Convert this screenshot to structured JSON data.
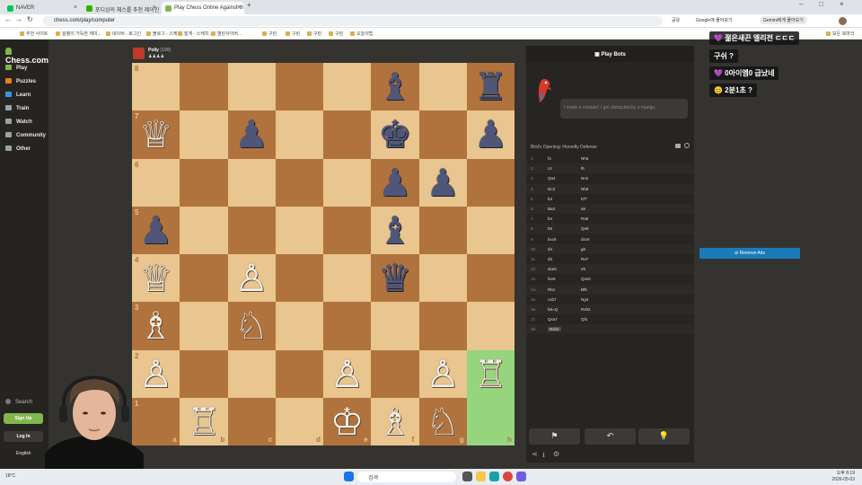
{
  "browser": {
    "tabs": [
      {
        "label": "NAVER",
        "color": "#03c75a"
      },
      {
        "label": "포디싱의 체스를 추천 제이민",
        "color": "#2db400"
      },
      {
        "label": "Play Chess Online Against th",
        "color": "#81b64c",
        "active": true
      }
    ],
    "url": "chess.com/play/computer",
    "right_buttons": [
      "공유",
      "Google에 물어보기"
    ],
    "gemini_label": "Gemini에게 물어보기",
    "bookmarks": [
      "추천 사이트",
      "설렘이 가득한 재미...",
      "네이버 - 로그인",
      "블로그 - 스케치...",
      "빌게 - 스케치...",
      "열린사이버...",
      "구린",
      "구린",
      "구린",
      "구린",
      "오늘의팁"
    ],
    "all_bookmarks": "모든 북마크"
  },
  "sidebar": {
    "logo": "Chess.com",
    "items": [
      {
        "label": "Play",
        "color": "#81b64c"
      },
      {
        "label": "Puzzles",
        "color": "#e67e22"
      },
      {
        "label": "Learn",
        "color": "#3498db"
      },
      {
        "label": "Train",
        "color": "#95a5a6"
      },
      {
        "label": "Watch",
        "color": "#95a5a6"
      },
      {
        "label": "Community",
        "color": "#95a5a6"
      },
      {
        "label": "Other",
        "color": "#95a5a6"
      }
    ],
    "search": "Search",
    "signup": "Sign Up",
    "login": "Log In",
    "language": "English"
  },
  "opponent": {
    "name": "Polly",
    "rating": "(100)",
    "captured": "♟♟♟♟"
  },
  "board": {
    "ranks": [
      "8",
      "7",
      "6",
      "5",
      "4",
      "3",
      "2",
      "1"
    ],
    "files": [
      "a",
      "b",
      "c",
      "d",
      "e",
      "f",
      "g",
      "h"
    ],
    "highlight": [
      "h2",
      "h1"
    ],
    "pieces": [
      {
        "sq": "f8",
        "g": "♝",
        "c": "black"
      },
      {
        "sq": "h8",
        "g": "♜",
        "c": "black"
      },
      {
        "sq": "a7",
        "g": "♕",
        "c": "white"
      },
      {
        "sq": "c7",
        "g": "♟",
        "c": "black"
      },
      {
        "sq": "f7",
        "g": "♚",
        "c": "black"
      },
      {
        "sq": "h7",
        "g": "♟",
        "c": "black"
      },
      {
        "sq": "f6",
        "g": "♟",
        "c": "black"
      },
      {
        "sq": "g6",
        "g": "♟",
        "c": "black"
      },
      {
        "sq": "a5",
        "g": "♟",
        "c": "black"
      },
      {
        "sq": "f5",
        "g": "♝",
        "c": "black"
      },
      {
        "sq": "a4",
        "g": "♕",
        "c": "white"
      },
      {
        "sq": "c4",
        "g": "♙",
        "c": "white"
      },
      {
        "sq": "f4",
        "g": "♛",
        "c": "black"
      },
      {
        "sq": "a3",
        "g": "♗",
        "c": "white"
      },
      {
        "sq": "c3",
        "g": "♘",
        "c": "white"
      },
      {
        "sq": "a2",
        "g": "♙",
        "c": "white"
      },
      {
        "sq": "e2",
        "g": "♙",
        "c": "white"
      },
      {
        "sq": "g2",
        "g": "♙",
        "c": "white"
      },
      {
        "sq": "h2",
        "g": "♖",
        "c": "white"
      },
      {
        "sq": "b1",
        "g": "♖",
        "c": "white"
      },
      {
        "sq": "e1",
        "g": "♔",
        "c": "white"
      },
      {
        "sq": "f1",
        "g": "♗",
        "c": "white"
      },
      {
        "sq": "g1",
        "g": "♘",
        "c": "white"
      }
    ]
  },
  "panel": {
    "title": "Play Bots",
    "bubble": "I made a mistake! I got distracted by a mango.",
    "opening": "Bird's Opening: Horsefly Defense",
    "moves": [
      [
        "1.",
        "f4",
        "Nh6"
      ],
      [
        "2.",
        "c4",
        "f6"
      ],
      [
        "3.",
        "Qa4",
        "Nc6"
      ],
      [
        "4.",
        "Nc3",
        "Nb8"
      ],
      [
        "5.",
        "b3",
        "Kf7"
      ],
      [
        "6.",
        "Ba3",
        "a5"
      ],
      [
        "7.",
        "b4",
        "Ra6"
      ],
      [
        "8.",
        "b5",
        "Qe8"
      ],
      [
        "9.",
        "bxc6",
        "dxc6"
      ],
      [
        "10.",
        "d4",
        "g6"
      ],
      [
        "11.",
        "d3",
        "Ra7"
      ],
      [
        "12.",
        "dxe6",
        "e5"
      ],
      [
        "13.",
        "fxe5",
        "Qxe5"
      ],
      [
        "14.",
        "Rb1",
        "Bf5"
      ],
      [
        "15.",
        "cxb7",
        "Ng4"
      ],
      [
        "16.",
        "b8=Q",
        "Rxb2"
      ],
      [
        "17.",
        "Qxa7",
        "Qf4"
      ],
      [
        "18.",
        "Rxh2",
        ""
      ]
    ],
    "buttons": [
      "⚑",
      "↶",
      "💡"
    ],
    "bottom_icons": [
      "⋖",
      "⭳",
      "⚙"
    ]
  },
  "chat": [
    "💜 젊은새끈 엘리전 ㄷㄷㄷ",
    "구쉬 ?",
    "💜 0아이엠0 급났네",
    "😊 2분1초 ?"
  ],
  "remove_ads": "⊘ Remove Ads",
  "taskbar": {
    "search": "검색",
    "time": "오후 8:19",
    "date": "2026-05-03",
    "weather": "18°C"
  },
  "colors": {
    "light_square": "#e9c58f",
    "dark_square": "#b1733d",
    "highlight": "#96d47e",
    "accent_green": "#81b64c",
    "ads_blue": "#1a7bb9"
  }
}
